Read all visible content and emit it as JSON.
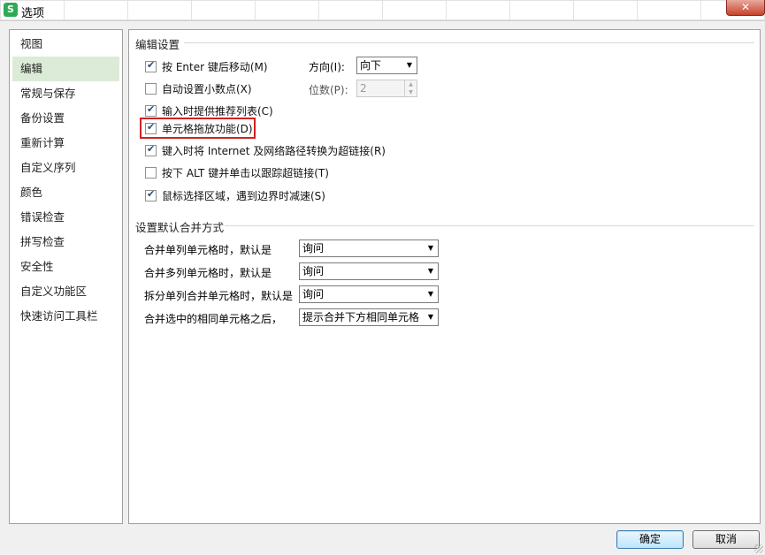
{
  "window": {
    "title": "选项",
    "icon_letter": "S",
    "close_label": "✕"
  },
  "sidebar": {
    "items": [
      {
        "label": "视图"
      },
      {
        "label": "编辑"
      },
      {
        "label": "常规与保存"
      },
      {
        "label": "备份设置"
      },
      {
        "label": "重新计算"
      },
      {
        "label": "自定义序列"
      },
      {
        "label": "颜色"
      },
      {
        "label": "错误检查"
      },
      {
        "label": "拼写检查"
      },
      {
        "label": "安全性"
      },
      {
        "label": "自定义功能区"
      },
      {
        "label": "快速访问工具栏"
      }
    ],
    "active": "编辑"
  },
  "edit_settings": {
    "title": "编辑设置",
    "options": [
      {
        "label": "按 Enter 键后移动(M)",
        "checked": true
      },
      {
        "label": "自动设置小数点(X)",
        "checked": false
      },
      {
        "label": "输入时提供推荐列表(C)",
        "checked": true
      },
      {
        "label": "单元格拖放功能(D)",
        "checked": true
      },
      {
        "label": "键入时将 Internet 及网络路径转换为超链接(R)",
        "checked": true
      },
      {
        "label": "按下 ALT 键并单击以跟踪超链接(T)",
        "checked": false
      },
      {
        "label": "鼠标选择区域，遇到边界时减速(S)",
        "checked": true
      }
    ],
    "direction_label": "方向(I):",
    "direction_value": "向下",
    "places_label": "位数(P):",
    "places_value": "2"
  },
  "merge_settings": {
    "title": "设置默认合并方式",
    "rows": [
      {
        "label": "合并单列单元格时，默认是",
        "value": "询问"
      },
      {
        "label": "合并多列单元格时，默认是",
        "value": "询问"
      },
      {
        "label": "拆分单列合并单元格时，默认是",
        "value": "询问"
      },
      {
        "label": "合并选中的相同单元格之后，",
        "value": "提示合并下方相同单元格"
      }
    ]
  },
  "footer": {
    "ok_label": "确定",
    "cancel_label": "取消"
  }
}
